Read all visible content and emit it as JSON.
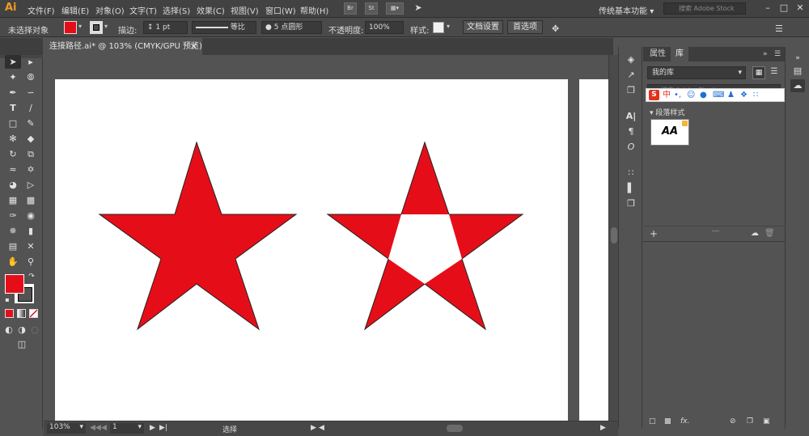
{
  "app": {
    "logo": "Ai"
  },
  "menu": {
    "items": [
      "文件(F)",
      "编辑(E)",
      "对象(O)",
      "文字(T)",
      "选择(S)",
      "效果(C)",
      "视图(V)",
      "窗口(W)",
      "帮助(H)"
    ],
    "bridge": "Br",
    "stock": "St",
    "workspace": "传统基本功能",
    "search_placeholder": "搜索 Adobe Stock"
  },
  "control": {
    "selection_status": "未选择对象",
    "stroke_label": "描边:",
    "stroke_weight": "1 pt",
    "profile": "等比",
    "brush": "5 点圆形",
    "opacity_label": "不透明度:",
    "opacity_value": "100%",
    "style_label": "样式:",
    "doc_setup": "文档设置",
    "preferences": "首选项"
  },
  "document": {
    "tab_title": "连接路径.ai* @ 103% (CMYK/GPU 预览)"
  },
  "status": {
    "zoom": "103%",
    "artboard_number": "1",
    "tool_name": "选择"
  },
  "panel": {
    "tabs": [
      "属性",
      "库"
    ],
    "library_name": "我的库",
    "search_placeholder": "搜索 Adobe Stock",
    "section_title": "段落样式",
    "thumbnail_text": "AA"
  },
  "ime": {
    "lang": "中"
  },
  "colors": {
    "fill": "#e50e18",
    "star": "#e50e18",
    "accent": "#f29a1f"
  }
}
